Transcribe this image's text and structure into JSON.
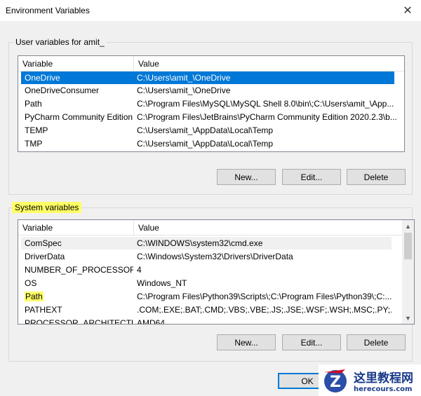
{
  "window": {
    "title": "Environment Variables",
    "close_glyph": "✕"
  },
  "user_vars": {
    "group_label": "User variables for amit_",
    "header": {
      "variable": "Variable",
      "value": "Value"
    },
    "rows": [
      {
        "variable": "OneDrive",
        "value": "C:\\Users\\amit_\\OneDrive",
        "selected": true
      },
      {
        "variable": "OneDriveConsumer",
        "value": "C:\\Users\\amit_\\OneDrive"
      },
      {
        "variable": "Path",
        "value": "C:\\Program Files\\MySQL\\MySQL Shell 8.0\\bin\\;C:\\Users\\amit_\\App..."
      },
      {
        "variable": "PyCharm Community Edition",
        "value": "C:\\Program Files\\JetBrains\\PyCharm Community Edition 2020.2.3\\b..."
      },
      {
        "variable": "TEMP",
        "value": "C:\\Users\\amit_\\AppData\\Local\\Temp"
      },
      {
        "variable": "TMP",
        "value": "C:\\Users\\amit_\\AppData\\Local\\Temp"
      }
    ],
    "buttons": {
      "new": "New...",
      "edit": "Edit...",
      "delete": "Delete"
    }
  },
  "system_vars": {
    "group_label": "System variables",
    "header": {
      "variable": "Variable",
      "value": "Value"
    },
    "rows": [
      {
        "variable": "ComSpec",
        "value": "C:\\WINDOWS\\system32\\cmd.exe"
      },
      {
        "variable": "DriverData",
        "value": "C:\\Windows\\System32\\Drivers\\DriverData"
      },
      {
        "variable": "NUMBER_OF_PROCESSORS",
        "value": "4"
      },
      {
        "variable": "OS",
        "value": "Windows_NT"
      },
      {
        "variable": "Path",
        "value": "C:\\Program Files\\Python39\\Scripts\\;C:\\Program Files\\Python39\\;C:..."
      },
      {
        "variable": "PATHEXT",
        "value": ".COM;.EXE;.BAT;.CMD;.VBS;.VBE;.JS;.JSE;.WSF;.WSH;.MSC;.PY;.PYW"
      },
      {
        "variable": "PROCESSOR_ARCHITECTURE",
        "value": "AMD64"
      }
    ],
    "buttons": {
      "new": "New...",
      "edit": "Edit...",
      "delete": "Delete"
    }
  },
  "footer": {
    "ok": "OK"
  },
  "watermark": {
    "title": "这里教程网",
    "subtitle": "herecours.com"
  },
  "colors": {
    "selection": "#0078d7",
    "highlight": "#ffff66",
    "dialog_bg": "#f0f0f0"
  }
}
